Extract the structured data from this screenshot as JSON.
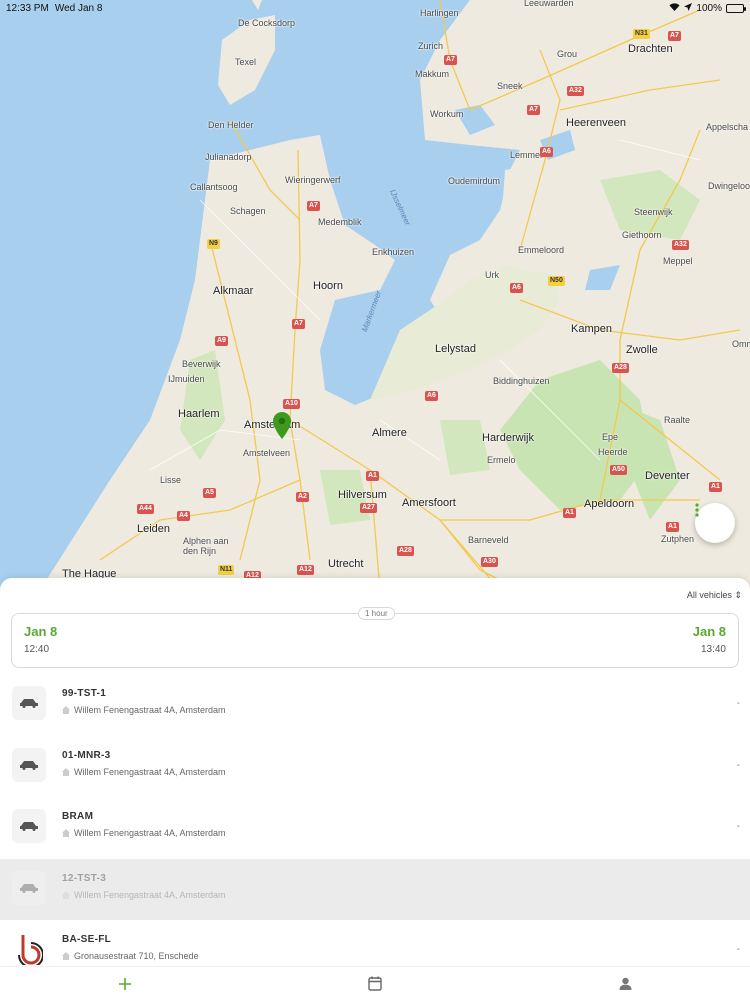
{
  "status_bar": {
    "time": "12:33 PM",
    "date": "Wed Jan 8",
    "battery": "100%"
  },
  "map": {
    "places": [
      {
        "id": "de-cocksdorp",
        "label": "De Cocksdorp"
      },
      {
        "id": "texel",
        "label": "Texel"
      },
      {
        "id": "den-helder",
        "label": "Den Helder"
      },
      {
        "id": "julianadorp",
        "label": "Julianadorp"
      },
      {
        "id": "callantsoog",
        "label": "Callantsoog"
      },
      {
        "id": "schagen",
        "label": "Schagen"
      },
      {
        "id": "wieringerwerf",
        "label": "Wieringerwerf"
      },
      {
        "id": "medemblik",
        "label": "Medemblik"
      },
      {
        "id": "enkhuizen",
        "label": "Enkhuizen"
      },
      {
        "id": "alkmaar",
        "label": "Alkmaar"
      },
      {
        "id": "hoorn",
        "label": "Hoorn"
      },
      {
        "id": "beverwijk",
        "label": "Beverwijk"
      },
      {
        "id": "ijmuiden",
        "label": "IJmuiden"
      },
      {
        "id": "haarlem",
        "label": "Haarlem"
      },
      {
        "id": "amsterdam",
        "label": "Amsterdam"
      },
      {
        "id": "amstelveen",
        "label": "Amstelveen"
      },
      {
        "id": "lisse",
        "label": "Lisse"
      },
      {
        "id": "leiden",
        "label": "Leiden"
      },
      {
        "id": "alphen",
        "label": "Alphen aan\nden Rijn"
      },
      {
        "id": "the-hague",
        "label": "The Hague"
      },
      {
        "id": "hilversum",
        "label": "Hilversum"
      },
      {
        "id": "utrecht",
        "label": "Utrecht"
      },
      {
        "id": "almere",
        "label": "Almere"
      },
      {
        "id": "lelystad",
        "label": "Lelystad"
      },
      {
        "id": "biddinghuizen",
        "label": "Biddinghuizen"
      },
      {
        "id": "harderwijk",
        "label": "Harderwijk"
      },
      {
        "id": "ermelo",
        "label": "Ermelo"
      },
      {
        "id": "amersfoort",
        "label": "Amersfoort"
      },
      {
        "id": "barneveld",
        "label": "Barneveld"
      },
      {
        "id": "apeldoorn",
        "label": "Apeldoorn"
      },
      {
        "id": "epe",
        "label": "Epe"
      },
      {
        "id": "heerde",
        "label": "Heerde"
      },
      {
        "id": "raalte",
        "label": "Raalte"
      },
      {
        "id": "deventer",
        "label": "Deventer"
      },
      {
        "id": "zutphen",
        "label": "Zutphen"
      },
      {
        "id": "zwolle",
        "label": "Zwolle"
      },
      {
        "id": "kampen",
        "label": "Kampen"
      },
      {
        "id": "urk",
        "label": "Urk"
      },
      {
        "id": "emmeloord",
        "label": "Emmeloord"
      },
      {
        "id": "lemmer",
        "label": "Lemmer"
      },
      {
        "id": "oudemirdum",
        "label": "Oudemirdum"
      },
      {
        "id": "workum",
        "label": "Workum"
      },
      {
        "id": "makkum",
        "label": "Makkum"
      },
      {
        "id": "zurich",
        "label": "Zurich"
      },
      {
        "id": "harlingen",
        "label": "Harlingen"
      },
      {
        "id": "sneek",
        "label": "Sneek"
      },
      {
        "id": "grou",
        "label": "Grou"
      },
      {
        "id": "drachten",
        "label": "Drachten"
      },
      {
        "id": "heerenveen",
        "label": "Heerenveen"
      },
      {
        "id": "appelscha",
        "label": "Appelscha"
      },
      {
        "id": "steenwijk",
        "label": "Steenwijk"
      },
      {
        "id": "giethoorn",
        "label": "Giethoorn"
      },
      {
        "id": "meppel",
        "label": "Meppel"
      },
      {
        "id": "dwingeloo",
        "label": "Dwingeloo"
      },
      {
        "id": "leeuwarden",
        "label": "Leeuwarden"
      },
      {
        "id": "ommen",
        "label": "Omm"
      },
      {
        "id": "markermeer",
        "label": "Markermeer"
      },
      {
        "id": "ijsselmeer",
        "label": "IJsselmeer"
      }
    ],
    "shields": [
      "A7",
      "A7",
      "A32",
      "A6",
      "A7",
      "N31",
      "A7",
      "A32",
      "A6",
      "N50",
      "N9",
      "A7",
      "A9",
      "A10",
      "A5",
      "A4",
      "A44",
      "A2",
      "A1",
      "A27",
      "A28",
      "A12",
      "N11",
      "A12",
      "A30",
      "A1",
      "A50",
      "A1",
      "A28",
      "A6",
      "A1"
    ]
  },
  "sheet": {
    "filter_label": "All vehicles",
    "duration": "1 hour",
    "start_date": "Jan 8",
    "start_time": "12:40",
    "end_date": "Jan 8",
    "end_time": "13:40"
  },
  "vehicles": [
    {
      "plate": "99-TST-1",
      "address": "Willem Fenengastraat  4A, Amsterdam",
      "status": "-",
      "icon": "car-icon",
      "dimmed": false
    },
    {
      "plate": "01-MNR-3",
      "address": "Willem Fenengastraat  4A, Amsterdam",
      "status": "-",
      "icon": "car-icon",
      "dimmed": false
    },
    {
      "plate": "BRAM",
      "address": "Willem Fenengastraat  4A, Amsterdam",
      "status": "-",
      "icon": "car-icon",
      "dimmed": false
    },
    {
      "plate": "12-TST-3",
      "address": "Willem Fenengastraat  4A, Amsterdam",
      "status": "",
      "icon": "car-icon",
      "dimmed": true
    },
    {
      "plate": "BA-SE-FL",
      "address": "Gronausestraat  710, Enschede",
      "status": "-",
      "icon": "brand-logo-icon",
      "dimmed": false
    }
  ],
  "tabs": [
    {
      "id": "add",
      "icon": "plus-icon"
    },
    {
      "id": "calendar",
      "icon": "calendar-icon"
    },
    {
      "id": "profile",
      "icon": "person-icon"
    }
  ],
  "colors": {
    "accent": "#5aa832",
    "water": "#a9cfee",
    "land": "#eeeae0",
    "green": "#c9e4b3"
  }
}
